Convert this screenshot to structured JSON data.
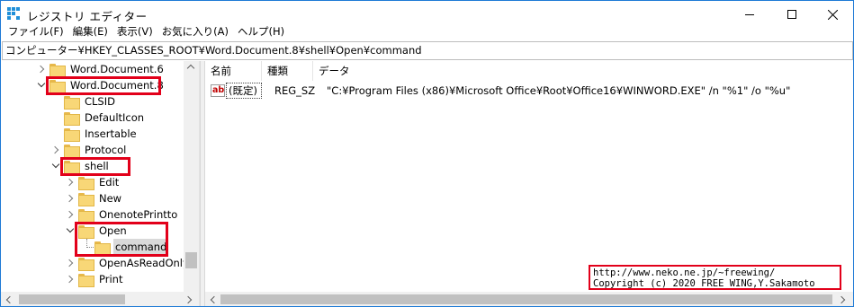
{
  "window": {
    "title": "レジストリ エディター"
  },
  "menu": [
    "ファイル(F)",
    "編集(E)",
    "表示(V)",
    "お気に入り(A)",
    "ヘルプ(H)"
  ],
  "address": "コンピューター¥HKEY_CLASSES_ROOT¥Word.Document.8¥shell¥Open¥command",
  "tree": [
    {
      "label": "Word.Document.6",
      "expander": "right"
    },
    {
      "label": "Word.Document.8",
      "expander": "down"
    },
    {
      "label": "CLSID",
      "expander": "none"
    },
    {
      "label": "DefaultIcon",
      "expander": "none"
    },
    {
      "label": "Insertable",
      "expander": "none"
    },
    {
      "label": "Protocol",
      "expander": "right"
    },
    {
      "label": "shell",
      "expander": "down"
    },
    {
      "label": "Edit",
      "expander": "right"
    },
    {
      "label": "New",
      "expander": "right"
    },
    {
      "label": "OnenotePrintto",
      "expander": "right"
    },
    {
      "label": "Open",
      "expander": "down"
    },
    {
      "label": "command",
      "expander": "none"
    },
    {
      "label": "OpenAsReadOnly",
      "expander": "right"
    },
    {
      "label": "Print",
      "expander": "right"
    }
  ],
  "list": {
    "columns": [
      "名前",
      "種類",
      "データ"
    ],
    "rows": [
      {
        "icon": "ab",
        "name": "(既定)",
        "type": "REG_SZ",
        "data": "\"C:¥Program Files (x86)¥Microsoft Office¥Root¥Office16¥WINWORD.EXE\" /n \"%1\" /o \"%u\""
      }
    ]
  },
  "credit": {
    "line1": "http://www.neko.ne.jp/~freewing/",
    "line2": "Copyright (c) 2020 FREE WING,Y.Sakamoto"
  },
  "colors": {
    "highlight": "#e2001a",
    "accent": "#1e7ad6"
  }
}
